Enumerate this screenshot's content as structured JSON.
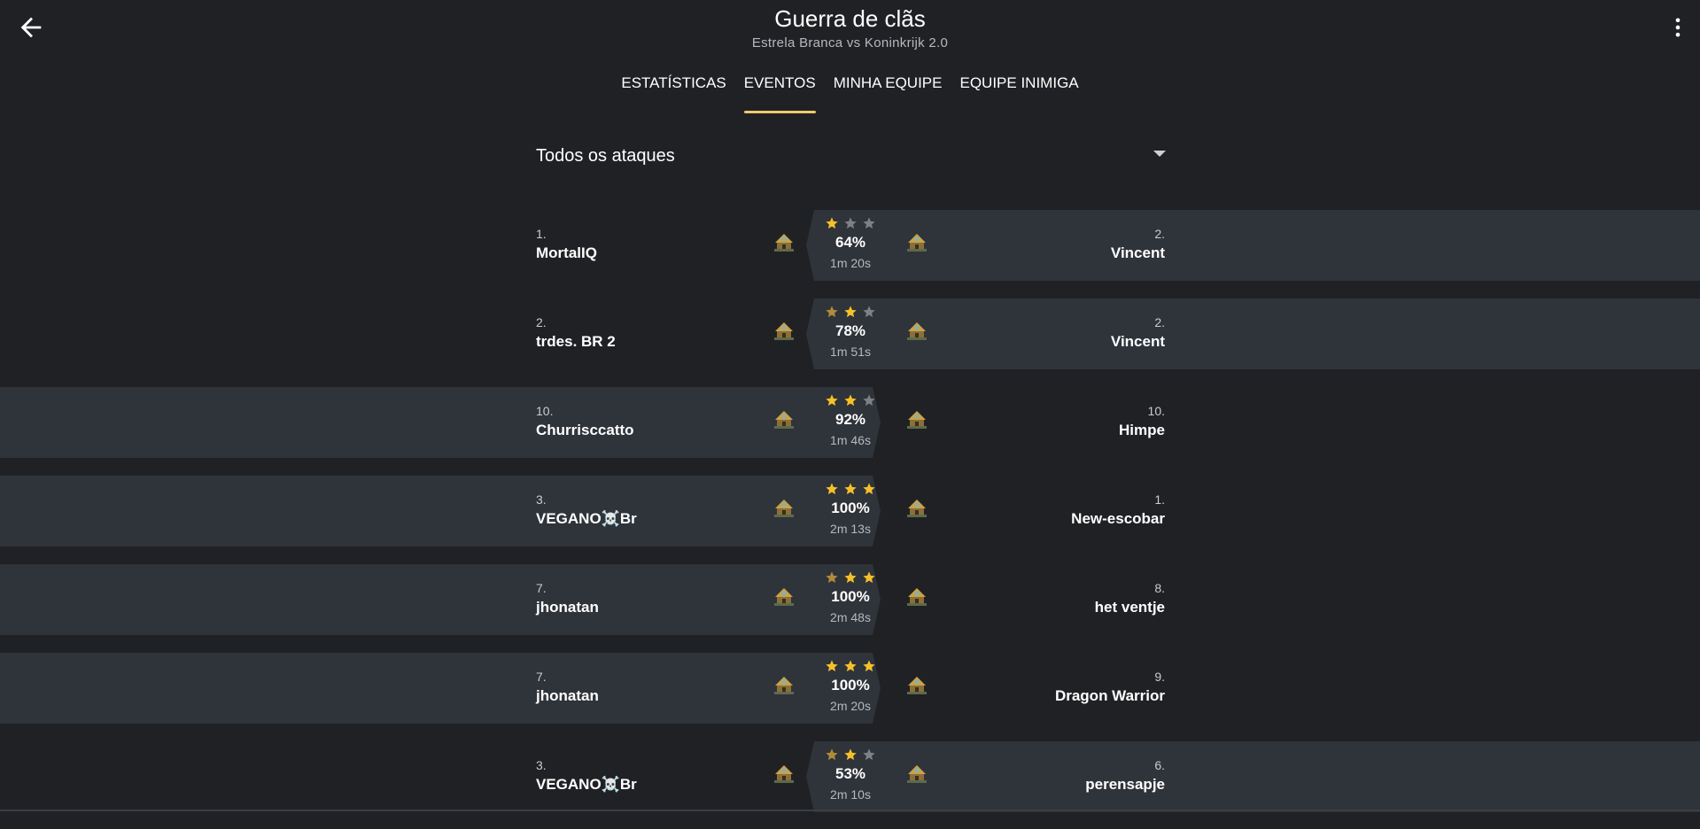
{
  "header": {
    "title": "Guerra de clãs",
    "subtitle": "Estrela Branca vs Koninkrijk 2.0",
    "back_icon": "arrow-left-icon",
    "menu_icon": "more-vert-icon"
  },
  "tabs": [
    {
      "label": "ESTATÍSTICAS",
      "active": false
    },
    {
      "label": "EVENTOS",
      "active": true
    },
    {
      "label": "MINHA EQUIPE",
      "active": false
    },
    {
      "label": "EQUIPE INIMIGA",
      "active": false
    }
  ],
  "filter": {
    "label": "Todos os ataques",
    "icon": "caret-down-icon"
  },
  "colors": {
    "background": "#202124",
    "row_highlight": "#2f333a",
    "tab_indicator": "#f0c96b",
    "star_gold": "#f5c02a",
    "star_dim_gold": "#b08b3a",
    "star_empty": "#7d8187"
  },
  "events": [
    {
      "highlight": "defender",
      "attacker": {
        "rank": "1.",
        "name": "MortalIQ"
      },
      "defender": {
        "rank": "2.",
        "name": "Vincent"
      },
      "stars": [
        "gold",
        "empty",
        "empty"
      ],
      "percent": "64%",
      "duration": "1m 20s"
    },
    {
      "highlight": "defender",
      "attacker": {
        "rank": "2.",
        "name": "trdes. BR 2"
      },
      "defender": {
        "rank": "2.",
        "name": "Vincent"
      },
      "stars": [
        "dim",
        "gold",
        "empty"
      ],
      "percent": "78%",
      "duration": "1m 51s"
    },
    {
      "highlight": "attacker",
      "attacker": {
        "rank": "10.",
        "name": "Churrisccatto"
      },
      "defender": {
        "rank": "10.",
        "name": "Himpe"
      },
      "stars": [
        "gold",
        "gold",
        "empty"
      ],
      "percent": "92%",
      "duration": "1m 46s"
    },
    {
      "highlight": "attacker",
      "attacker": {
        "rank": "3.",
        "name": "VEGANO☠️Br"
      },
      "defender": {
        "rank": "1.",
        "name": "New-escobar"
      },
      "stars": [
        "gold",
        "gold",
        "gold"
      ],
      "percent": "100%",
      "duration": "2m 13s"
    },
    {
      "highlight": "attacker",
      "attacker": {
        "rank": "7.",
        "name": "jhonatan"
      },
      "defender": {
        "rank": "8.",
        "name": "het ventje"
      },
      "stars": [
        "dim",
        "gold",
        "gold"
      ],
      "percent": "100%",
      "duration": "2m 48s"
    },
    {
      "highlight": "attacker",
      "attacker": {
        "rank": "7.",
        "name": "jhonatan"
      },
      "defender": {
        "rank": "9.",
        "name": "Dragon Warrior"
      },
      "stars": [
        "gold",
        "gold",
        "gold"
      ],
      "percent": "100%",
      "duration": "2m 20s"
    },
    {
      "highlight": "defender",
      "attacker": {
        "rank": "3.",
        "name": "VEGANO☠️Br"
      },
      "defender": {
        "rank": "6.",
        "name": "perensapje"
      },
      "stars": [
        "dim",
        "gold",
        "empty"
      ],
      "percent": "53%",
      "duration": "2m 10s"
    }
  ]
}
